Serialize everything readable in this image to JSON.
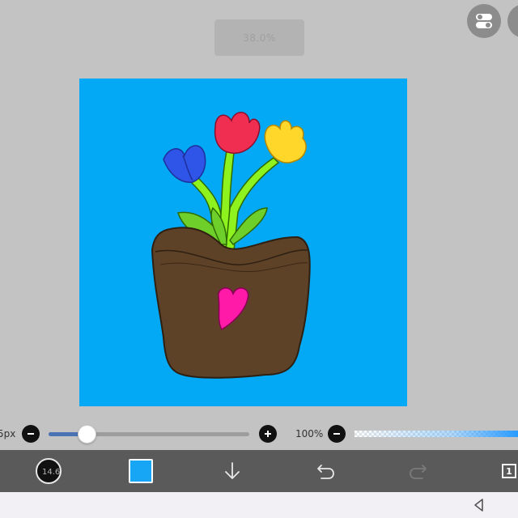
{
  "zoom": {
    "label": "38.0%"
  },
  "brush": {
    "size_label": "5px",
    "size_value": 14.6,
    "size_display": "14.6",
    "slider_fraction": 0.19
  },
  "opacity": {
    "label": "100%",
    "value": 100
  },
  "color": {
    "current": "#16a6f5"
  },
  "layers": {
    "count": "1"
  },
  "colors": {
    "background": "#c3c3c3",
    "canvas": "#03a9f4",
    "toolbar": "#5a5a5a",
    "slider_fill": "#4a73b5"
  },
  "icons": {
    "settings": "toggle-switches-icon",
    "more": "more-dots-icon",
    "brush": "brush-icon",
    "save": "arrow-down-icon",
    "undo": "undo-icon",
    "redo": "redo-icon",
    "layers": "layers-icon",
    "back": "triangle-back-icon"
  }
}
